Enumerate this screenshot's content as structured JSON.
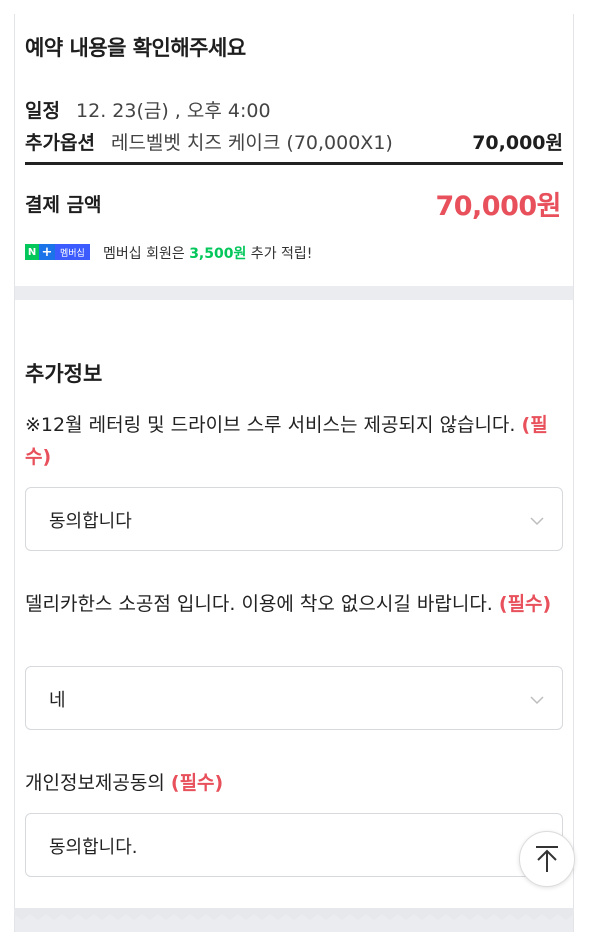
{
  "summary": {
    "title": "예약 내용을 확인해주세요",
    "schedule_label": "일정",
    "schedule_value": "12. 23(금) , 오후 4:00",
    "option_label": "추가옵션",
    "option_value": "레드벨벳 치즈 케이크 (70,000X1)",
    "option_amount": "70,000원",
    "payment_label": "결제 금액",
    "payment_amount": "70,000원"
  },
  "membership": {
    "badge_n": "N",
    "badge_plus": "+",
    "badge_text": "멤버십",
    "text_before": "멤버십 회원은 ",
    "points": "3,500원",
    "text_after": " 추가 적립!"
  },
  "extra_info": {
    "title": "추가정보",
    "questions": [
      {
        "text": "※12월 레터링 및 드라이브 스루 서비스는 제공되지 않습니다.",
        "required": "(필수)",
        "selected": "동의합니다"
      },
      {
        "text": "델리카한스 소공점 입니다. 이용에 착오 없으시길 바랍니다.",
        "required": "(필수)",
        "selected": "네"
      },
      {
        "text": "개인정보제공동의",
        "required": "(필수)",
        "selected": "동의합니다."
      }
    ]
  },
  "icons": {
    "dropdown": "chevron-down-icon",
    "scroll_top": "arrow-up-icon"
  },
  "colors": {
    "accent_red": "#e8505b",
    "naver_green": "#03c75a"
  }
}
